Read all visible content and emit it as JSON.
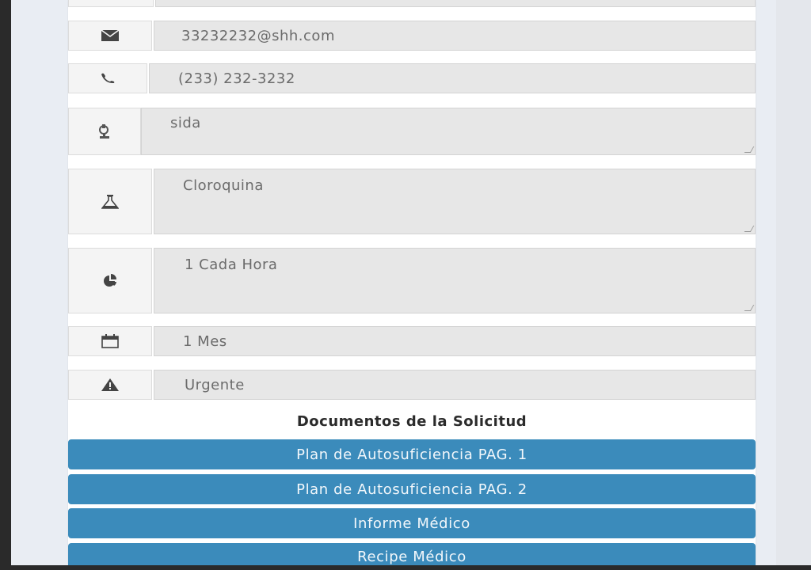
{
  "form": {
    "email": {
      "value": "33232232@shh.com",
      "icon": "envelope-icon"
    },
    "phone": {
      "value": "(233) 232-3232",
      "icon": "phone-icon"
    },
    "diagnosis": {
      "value": "sida",
      "icon": "microscope-icon"
    },
    "medication": {
      "value": "Cloroquina",
      "icon": "flask-icon"
    },
    "dosage": {
      "value": "1 Cada Hora",
      "icon": "pie-chart-icon"
    },
    "duration": {
      "value": "1 Mes",
      "icon": "calendar-icon"
    },
    "priority": {
      "value": "Urgente",
      "icon": "warning-icon"
    }
  },
  "documents": {
    "title": "Documentos de la Solicitud",
    "buttons": [
      {
        "label": "Plan de Autosuficiencia PAG. 1"
      },
      {
        "label": "Plan de Autosuficiencia PAG. 2"
      },
      {
        "label": "Informe Médico"
      },
      {
        "label": "Recipe Médico"
      }
    ]
  },
  "colors": {
    "button": "#3b8bbb",
    "field": "#e7e7e7",
    "addon": "#f4f4f4"
  }
}
